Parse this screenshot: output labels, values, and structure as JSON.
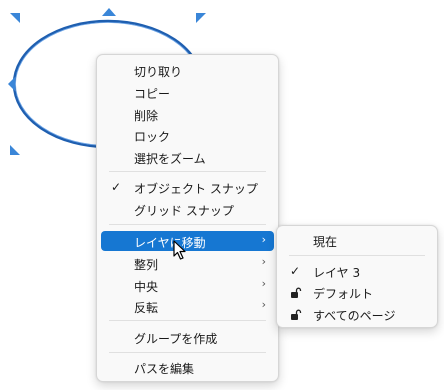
{
  "colors": {
    "ellipse_stroke": "#1f5fb0",
    "handle": "#3a86d8",
    "highlight": "#1677d2"
  },
  "context_menu": {
    "items": [
      {
        "label": "切り取り"
      },
      {
        "label": "コピー"
      },
      {
        "label": "削除"
      },
      {
        "label": "ロック"
      },
      {
        "label": "選択をズーム"
      },
      {
        "label": "オブジェクト スナップ",
        "checked": true
      },
      {
        "label": "グリッド スナップ"
      },
      {
        "label": "レイヤに移動",
        "has_submenu": true,
        "highlighted": true
      },
      {
        "label": "整列",
        "has_submenu": true
      },
      {
        "label": "中央",
        "has_submenu": true
      },
      {
        "label": "反転",
        "has_submenu": true
      },
      {
        "label": "グループを作成"
      },
      {
        "label": "パスを編集"
      }
    ]
  },
  "layer_submenu": {
    "items": [
      {
        "label": "現在"
      },
      {
        "label": "レイヤ 3",
        "checked": true
      },
      {
        "label": "デフォルト",
        "icon": "lock-icon"
      },
      {
        "label": "すべてのページ",
        "icon": "lock-icon"
      }
    ]
  },
  "icons": {
    "check": "✓",
    "submenu_arrow": "›"
  }
}
